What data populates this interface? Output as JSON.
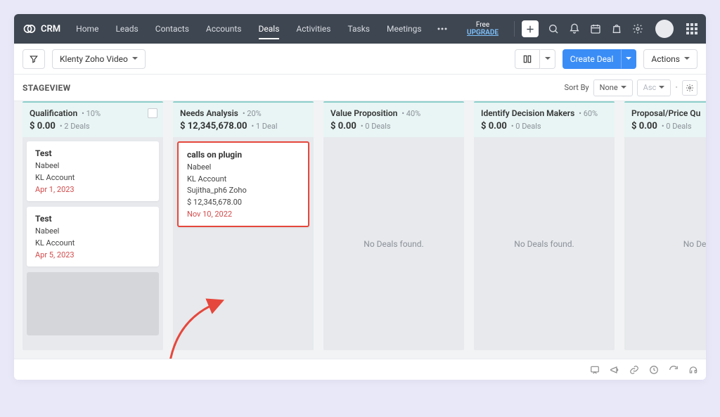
{
  "header": {
    "product": "CRM",
    "nav": [
      "Home",
      "Leads",
      "Contacts",
      "Accounts",
      "Deals",
      "Activities",
      "Tasks",
      "Meetings"
    ],
    "active_nav": "Deals",
    "upgrade_top": "Free",
    "upgrade_bottom": "UPGRADE"
  },
  "toolbar": {
    "view_name": "Klenty Zoho Video",
    "create_label": "Create Deal",
    "actions_label": "Actions"
  },
  "sortbar": {
    "stageview": "STAGEVIEW",
    "sortby": "Sort By",
    "sort_value": "None",
    "dir_value": "Asc"
  },
  "columns": [
    {
      "title": "Qualification",
      "percent": "10%",
      "amount": "$ 0.00",
      "deal_count": "2 Deals",
      "show_check": true,
      "cards": [
        {
          "title": "Test",
          "lines": [
            "Nabeel",
            "KL Account"
          ],
          "date": "Apr 1, 2023",
          "highlighted": false
        },
        {
          "title": "Test",
          "lines": [
            "Nabeel",
            "KL Account"
          ],
          "date": "Apr 5, 2023",
          "highlighted": false
        }
      ],
      "trailing_placeholder": true,
      "empty": false,
      "empty_text": ""
    },
    {
      "title": "Needs Analysis",
      "percent": "20%",
      "amount": "$ 12,345,678.00",
      "deal_count": "1 Deal",
      "show_check": false,
      "cards": [
        {
          "title": "calls on plugin",
          "lines": [
            "Nabeel",
            "KL Account",
            "Sujitha_ph6 Zoho",
            "$ 12,345,678.00"
          ],
          "date": "Nov 10, 2022",
          "highlighted": true
        }
      ],
      "trailing_placeholder": false,
      "empty": false,
      "empty_text": ""
    },
    {
      "title": "Value Proposition",
      "percent": "40%",
      "amount": "$ 0.00",
      "deal_count": "0 Deals",
      "show_check": false,
      "cards": [],
      "trailing_placeholder": false,
      "empty": true,
      "empty_text": "No Deals found."
    },
    {
      "title": "Identify Decision Makers",
      "percent": "60%",
      "amount": "$ 0.00",
      "deal_count": "0 Deals",
      "show_check": false,
      "cards": [],
      "trailing_placeholder": false,
      "empty": true,
      "empty_text": "No Deals found."
    },
    {
      "title": "Proposal/Price Qu",
      "percent": "",
      "amount": "$ 0.00",
      "deal_count": "0 Deals",
      "show_check": false,
      "cards": [],
      "trailing_placeholder": false,
      "empty": true,
      "empty_text": "No De"
    }
  ]
}
